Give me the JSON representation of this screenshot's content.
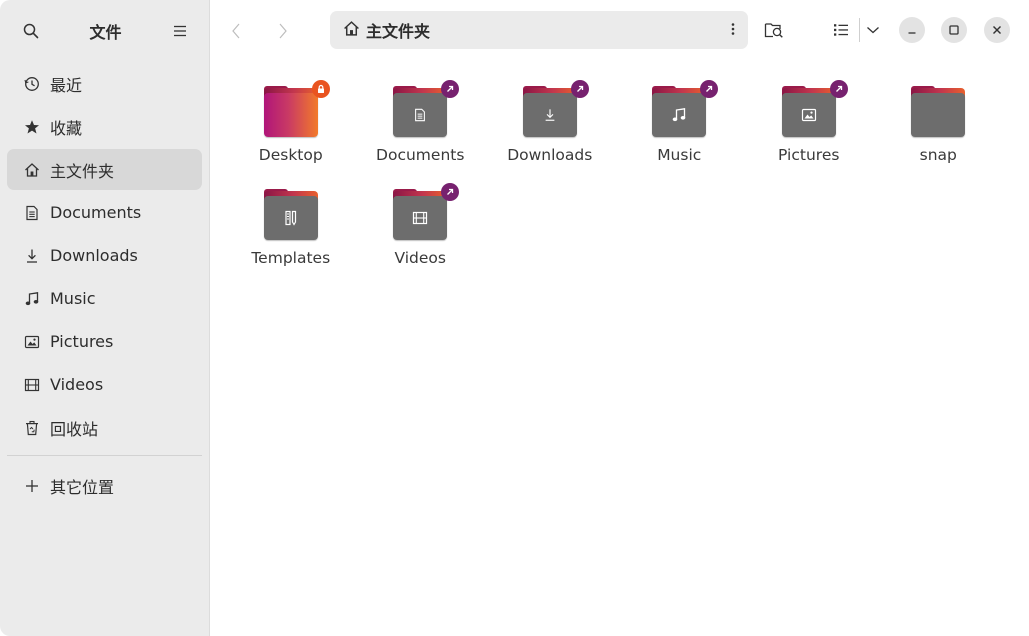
{
  "sidebar": {
    "title": "文件",
    "items": [
      {
        "label": "最近",
        "icon": "clock-icon"
      },
      {
        "label": "收藏",
        "icon": "star-icon"
      },
      {
        "label": "主文件夹",
        "icon": "home-icon"
      },
      {
        "label": "Documents",
        "icon": "document-icon"
      },
      {
        "label": "Downloads",
        "icon": "download-icon"
      },
      {
        "label": "Music",
        "icon": "music-icon"
      },
      {
        "label": "Pictures",
        "icon": "picture-icon"
      },
      {
        "label": "Videos",
        "icon": "film-icon"
      },
      {
        "label": "回收站",
        "icon": "trash-icon"
      }
    ],
    "other_locations": "其它位置",
    "active_item": "主文件夹"
  },
  "path": {
    "label": "主文件夹"
  },
  "files": [
    {
      "name": "Desktop",
      "emblem": "lock"
    },
    {
      "name": "Documents",
      "emblem": "link"
    },
    {
      "name": "Downloads",
      "emblem": "link"
    },
    {
      "name": "Music",
      "emblem": "link"
    },
    {
      "name": "Pictures",
      "emblem": "link"
    },
    {
      "name": "snap",
      "emblem": "none"
    },
    {
      "name": "Templates",
      "emblem": "none"
    },
    {
      "name": "Videos",
      "emblem": "link"
    }
  ],
  "colors": {
    "accent_orange": "#e95420",
    "link_purple": "#77216f",
    "sidebar_bg": "#ebebeb"
  }
}
